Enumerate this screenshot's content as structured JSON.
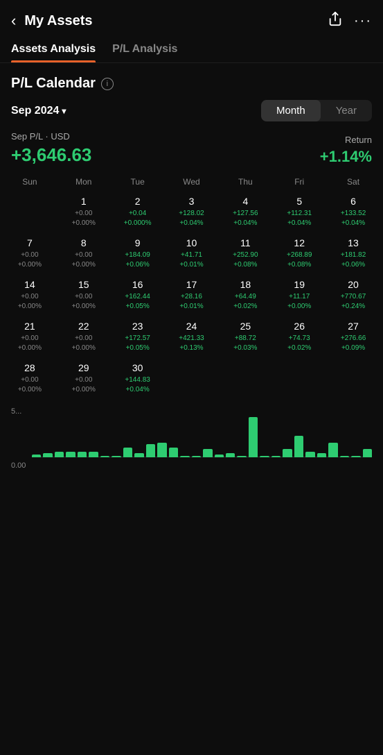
{
  "header": {
    "title": "My Assets",
    "back_icon": "‹",
    "share_icon": "⬆",
    "more_icon": "···"
  },
  "tabs": [
    {
      "id": "assets",
      "label": "Assets Analysis",
      "active": true
    },
    {
      "id": "pl",
      "label": "P/L Analysis",
      "active": false
    }
  ],
  "section": {
    "title": "P/L Calendar",
    "info_icon": "i"
  },
  "period": {
    "label": "Sep 2024"
  },
  "view_toggle": {
    "month_label": "Month",
    "year_label": "Year"
  },
  "summary": {
    "pl_label": "Sep P/L · USD",
    "pl_value": "+3,646.63",
    "return_label": "Return",
    "return_value": "+1.14%"
  },
  "dow_labels": [
    "Sun",
    "Mon",
    "Tue",
    "Wed",
    "Thu",
    "Fri",
    "Sat"
  ],
  "weeks": [
    [
      {
        "day": "",
        "pl": "",
        "pct": ""
      },
      {
        "day": "1",
        "pl": "+0.00",
        "pct": "+0.00%"
      },
      {
        "day": "2",
        "pl": "+0.04",
        "pct": "+0.000%"
      },
      {
        "day": "3",
        "pl": "+128.02",
        "pct": "+0.04%"
      },
      {
        "day": "4",
        "pl": "+127.56",
        "pct": "+0.04%"
      },
      {
        "day": "5",
        "pl": "+112.31",
        "pct": "+0.04%"
      },
      {
        "day": "6",
        "pl": "+133.52",
        "pct": "+0.04%"
      }
    ],
    [
      {
        "day": "7",
        "pl": "+0.00",
        "pct": "+0.00%"
      },
      {
        "day": "8",
        "pl": "+0.00",
        "pct": "+0.00%"
      },
      {
        "day": "9",
        "pl": "+184.09",
        "pct": "+0.06%"
      },
      {
        "day": "10",
        "pl": "+41.71",
        "pct": "+0.01%"
      },
      {
        "day": "11",
        "pl": "+252.90",
        "pct": "+0.08%"
      },
      {
        "day": "12",
        "pl": "+268.89",
        "pct": "+0.08%"
      },
      {
        "day": "13",
        "pl": "+181.82",
        "pct": "+0.06%"
      }
    ],
    [
      {
        "day": "14",
        "pl": "+0.00",
        "pct": "+0.00%"
      },
      {
        "day": "15",
        "pl": "+0.00",
        "pct": "+0.00%"
      },
      {
        "day": "16",
        "pl": "+162.44",
        "pct": "+0.05%"
      },
      {
        "day": "17",
        "pl": "+28.16",
        "pct": "+0.01%"
      },
      {
        "day": "18",
        "pl": "+64.49",
        "pct": "+0.02%"
      },
      {
        "day": "19",
        "pl": "+11.17",
        "pct": "+0.00%"
      },
      {
        "day": "20",
        "pl": "+770.67",
        "pct": "+0.24%"
      }
    ],
    [
      {
        "day": "21",
        "pl": "+0.00",
        "pct": "+0.00%"
      },
      {
        "day": "22",
        "pl": "+0.00",
        "pct": "+0.00%"
      },
      {
        "day": "23",
        "pl": "+172.57",
        "pct": "+0.05%"
      },
      {
        "day": "24",
        "pl": "+421.33",
        "pct": "+0.13%"
      },
      {
        "day": "25",
        "pl": "+88.72",
        "pct": "+0.03%"
      },
      {
        "day": "26",
        "pl": "+74.73",
        "pct": "+0.02%"
      },
      {
        "day": "27",
        "pl": "+276.66",
        "pct": "+0.09%"
      }
    ],
    [
      {
        "day": "28",
        "pl": "+0.00",
        "pct": "+0.00%"
      },
      {
        "day": "29",
        "pl": "+0.00",
        "pct": "+0.00%"
      },
      {
        "day": "30",
        "pl": "+144.83",
        "pct": "+0.04%"
      },
      {
        "day": "",
        "pl": "",
        "pct": ""
      },
      {
        "day": "",
        "pl": "",
        "pct": ""
      },
      {
        "day": "",
        "pl": "",
        "pct": ""
      },
      {
        "day": "",
        "pl": "",
        "pct": ""
      }
    ]
  ],
  "chart": {
    "y_top": "5...",
    "y_bottom": "0.00",
    "bars": [
      2,
      3,
      4,
      4,
      4,
      4,
      1,
      1,
      7,
      3,
      9,
      10,
      7,
      1,
      1,
      6,
      2,
      3,
      1,
      28,
      1,
      1,
      6,
      15,
      4,
      3,
      10,
      1,
      1,
      6
    ]
  }
}
